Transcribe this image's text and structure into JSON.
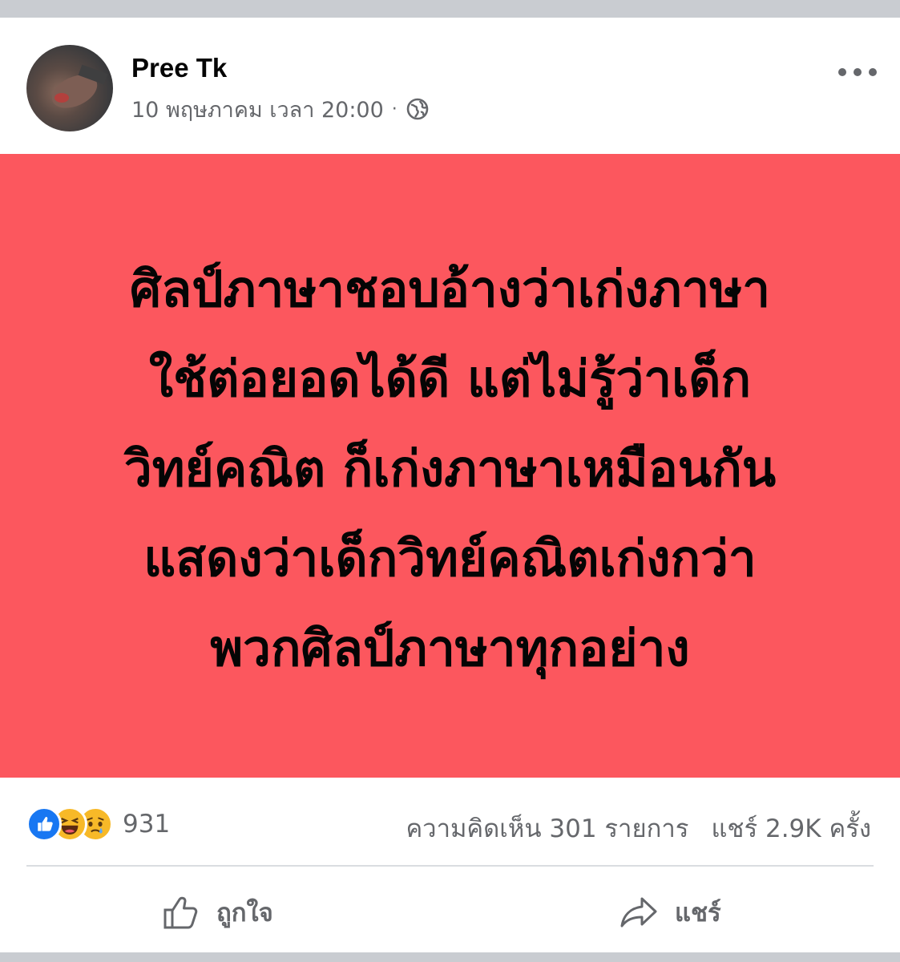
{
  "post": {
    "author": "Pree Tk",
    "date": "10 พฤษภาคม เวลา 20:00",
    "separator": "·",
    "privacy_icon": "globe-icon",
    "more_icon": "more-options-icon",
    "banner": {
      "background": "#fc575e",
      "lines": [
        "ศิลป์ภาษาชอบอ้างว่าเก่งภาษา",
        "ใช้ต่อยอดได้ดี แต่ไม่รู้ว่าเด็ก",
        "วิทย์คณิต ก็เก่งภาษาเหมือนกัน",
        "แสดงว่าเด็กวิทย์คณิตเก่งกว่า",
        "พวกศิลป์ภาษาทุกอย่าง"
      ]
    },
    "stats": {
      "reactions": [
        "like-reaction-icon",
        "haha-reaction-icon",
        "sad-reaction-icon"
      ],
      "reaction_count": "931",
      "comments": "ความคิดเห็น 301 รายการ",
      "shares": "แชร์ 2.9K ครั้ง"
    },
    "actions": {
      "like_label": "ถูกใจ",
      "share_label": "แชร์"
    }
  },
  "colors": {
    "accent_blue": "#1877f2",
    "muted_text": "#65676b",
    "reaction_yellow": "#f7b928"
  }
}
